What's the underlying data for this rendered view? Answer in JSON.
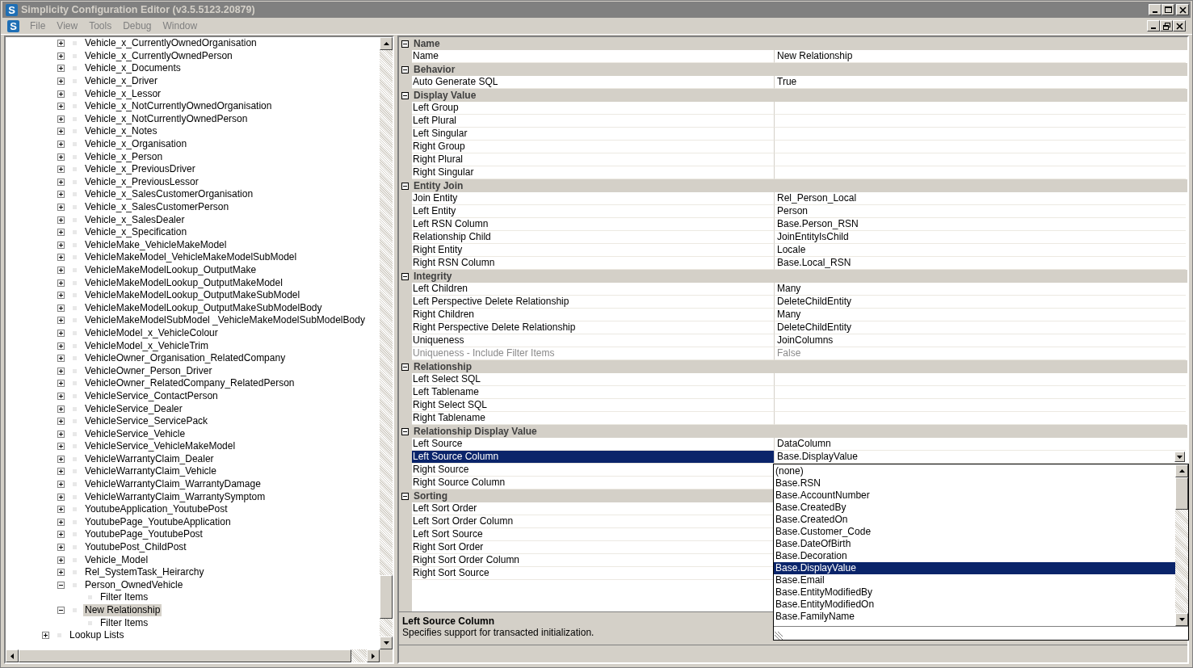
{
  "window": {
    "title": "Simplicity Configuration Editor (v3.5.5123.20879)",
    "icon_letter": "S"
  },
  "menu_bar": {
    "icon_letter": "S",
    "items": [
      "File",
      "View",
      "Tools",
      "Debug",
      "Window"
    ]
  },
  "tree": {
    "nodes": [
      {
        "label": "Vehicle_x_CurrentlyOwnedOrganisation",
        "expanded": false,
        "selected": false
      },
      {
        "label": "Vehicle_x_CurrentlyOwnedPerson",
        "expanded": false,
        "selected": false
      },
      {
        "label": "Vehicle_x_Documents",
        "expanded": false,
        "selected": false
      },
      {
        "label": "Vehicle_x_Driver",
        "expanded": false,
        "selected": false
      },
      {
        "label": "Vehicle_x_Lessor",
        "expanded": false,
        "selected": false
      },
      {
        "label": "Vehicle_x_NotCurrentlyOwnedOrganisation",
        "expanded": false,
        "selected": false
      },
      {
        "label": "Vehicle_x_NotCurrentlyOwnedPerson",
        "expanded": false,
        "selected": false
      },
      {
        "label": "Vehicle_x_Notes",
        "expanded": false,
        "selected": false
      },
      {
        "label": "Vehicle_x_Organisation",
        "expanded": false,
        "selected": false
      },
      {
        "label": "Vehicle_x_Person",
        "expanded": false,
        "selected": false
      },
      {
        "label": "Vehicle_x_PreviousDriver",
        "expanded": false,
        "selected": false
      },
      {
        "label": "Vehicle_x_PreviousLessor",
        "expanded": false,
        "selected": false
      },
      {
        "label": "Vehicle_x_SalesCustomerOrganisation",
        "expanded": false,
        "selected": false
      },
      {
        "label": "Vehicle_x_SalesCustomerPerson",
        "expanded": false,
        "selected": false
      },
      {
        "label": "Vehicle_x_SalesDealer",
        "expanded": false,
        "selected": false
      },
      {
        "label": "Vehicle_x_Specification",
        "expanded": false,
        "selected": false
      },
      {
        "label": "VehicleMake_VehicleMakeModel",
        "expanded": false,
        "selected": false
      },
      {
        "label": "VehicleMakeModel_VehicleMakeModelSubModel",
        "expanded": false,
        "selected": false
      },
      {
        "label": "VehicleMakeModelLookup_OutputMake",
        "expanded": false,
        "selected": false
      },
      {
        "label": "VehicleMakeModelLookup_OutputMakeModel",
        "expanded": false,
        "selected": false
      },
      {
        "label": "VehicleMakeModelLookup_OutputMakeSubModel",
        "expanded": false,
        "selected": false
      },
      {
        "label": "VehicleMakeModelLookup_OutputMakeSubModelBody",
        "expanded": false,
        "selected": false
      },
      {
        "label": "VehicleMakeModelSubModel _VehicleMakeModelSubModelBody",
        "expanded": false,
        "selected": false
      },
      {
        "label": "VehicleModel_x_VehicleColour",
        "expanded": false,
        "selected": false
      },
      {
        "label": "VehicleModel_x_VehicleTrim",
        "expanded": false,
        "selected": false
      },
      {
        "label": "VehicleOwner_Organisation_RelatedCompany",
        "expanded": false,
        "selected": false
      },
      {
        "label": "VehicleOwner_Person_Driver",
        "expanded": false,
        "selected": false
      },
      {
        "label": "VehicleOwner_RelatedCompany_RelatedPerson",
        "expanded": false,
        "selected": false
      },
      {
        "label": "VehicleService_ContactPerson",
        "expanded": false,
        "selected": false
      },
      {
        "label": "VehicleService_Dealer",
        "expanded": false,
        "selected": false
      },
      {
        "label": "VehicleService_ServicePack",
        "expanded": false,
        "selected": false
      },
      {
        "label": "VehicleService_Vehicle",
        "expanded": false,
        "selected": false
      },
      {
        "label": "VehicleService_VehicleMakeModel",
        "expanded": false,
        "selected": false
      },
      {
        "label": "VehicleWarrantyClaim_Dealer",
        "expanded": false,
        "selected": false
      },
      {
        "label": "VehicleWarrantyClaim_Vehicle",
        "expanded": false,
        "selected": false
      },
      {
        "label": "VehicleWarrantyClaim_WarrantyDamage",
        "expanded": false,
        "selected": false
      },
      {
        "label": "VehicleWarrantyClaim_WarrantySymptom",
        "expanded": false,
        "selected": false
      },
      {
        "label": "YoutubeApplication_YoutubePost",
        "expanded": false,
        "selected": false
      },
      {
        "label": "YoutubePage_YoutubeApplication",
        "expanded": false,
        "selected": false
      },
      {
        "label": "YoutubePage_YoutubePost",
        "expanded": false,
        "selected": false
      },
      {
        "label": "YoutubePost_ChildPost",
        "expanded": false,
        "selected": false
      },
      {
        "label": "Vehicle_Model",
        "expanded": false,
        "selected": false
      },
      {
        "label": "Rel_SystemTask_Heirarchy",
        "expanded": false,
        "selected": false
      },
      {
        "label": "Person_OwnedVehicle",
        "expanded": true,
        "selected": false,
        "children": [
          {
            "label": "Filter Items",
            "selected": false
          }
        ]
      },
      {
        "label": "New Relationship",
        "expanded": true,
        "selected": true,
        "children": [
          {
            "label": "Filter Items",
            "selected": false
          }
        ]
      }
    ],
    "root_nodes": [
      {
        "label": "Lookup Lists",
        "expanded": false,
        "selected": false
      }
    ]
  },
  "properties": {
    "categories": [
      {
        "name": "Name",
        "expanded": true,
        "rows": [
          {
            "name": "Name",
            "value": "New Relationship",
            "disabled": false,
            "selected": false
          }
        ]
      },
      {
        "name": "Behavior",
        "expanded": true,
        "rows": [
          {
            "name": "Auto Generate SQL",
            "value": "True",
            "disabled": false,
            "selected": false
          }
        ]
      },
      {
        "name": "Display Value",
        "expanded": true,
        "rows": [
          {
            "name": "Left Group",
            "disabled": false,
            "selected": false
          },
          {
            "name": "Left Plural",
            "disabled": false,
            "selected": false
          },
          {
            "name": "Left Singular",
            "disabled": false,
            "selected": false
          },
          {
            "name": "Right Group",
            "disabled": false,
            "selected": false
          },
          {
            "name": "Right Plural",
            "disabled": false,
            "selected": false
          },
          {
            "name": "Right Singular",
            "disabled": false,
            "selected": false
          }
        ]
      },
      {
        "name": "Entity Join",
        "expanded": true,
        "rows": [
          {
            "name": "Join Entity",
            "value": "Rel_Person_Local",
            "disabled": false,
            "selected": false
          },
          {
            "name": "Left Entity",
            "value": "Person",
            "disabled": false,
            "selected": false
          },
          {
            "name": "Left RSN Column",
            "value": "Base.Person_RSN",
            "disabled": false,
            "selected": false
          },
          {
            "name": "Relationship Child",
            "value": "JoinEntityIsChild",
            "disabled": false,
            "selected": false
          },
          {
            "name": "Right Entity",
            "value": "Locale",
            "disabled": false,
            "selected": false
          },
          {
            "name": "Right RSN Column",
            "value": "Base.Local_RSN",
            "disabled": false,
            "selected": false
          }
        ]
      },
      {
        "name": "Integrity",
        "expanded": true,
        "rows": [
          {
            "name": "Left Children",
            "value": "Many",
            "disabled": false,
            "selected": false
          },
          {
            "name": "Left Perspective Delete Relationship",
            "value": "DeleteChildEntity",
            "disabled": false,
            "selected": false
          },
          {
            "name": "Right Children",
            "value": "Many",
            "disabled": false,
            "selected": false
          },
          {
            "name": "Right Perspective Delete Relationship",
            "value": "DeleteChildEntity",
            "disabled": false,
            "selected": false
          },
          {
            "name": "Uniqueness",
            "value": "JoinColumns",
            "disabled": false,
            "selected": false
          },
          {
            "name": "Uniqueness - Include Filter Items",
            "value": "False",
            "disabled": true,
            "selected": false
          }
        ]
      },
      {
        "name": "Relationship",
        "expanded": true,
        "rows": [
          {
            "name": "Left Select SQL",
            "disabled": false,
            "selected": false
          },
          {
            "name": "Left Tablename",
            "disabled": false,
            "selected": false
          },
          {
            "name": "Right Select SQL",
            "disabled": false,
            "selected": false
          },
          {
            "name": "Right Tablename",
            "disabled": false,
            "selected": false
          }
        ]
      },
      {
        "name": "Relationship Display Value",
        "expanded": true,
        "rows": [
          {
            "name": "Left Source",
            "value": "DataColumn",
            "disabled": false,
            "selected": false
          },
          {
            "name": "Left Source Column",
            "value": "Base.DisplayValue",
            "disabled": false,
            "selected": true
          },
          {
            "name": "Right Source",
            "disabled": false,
            "selected": false
          },
          {
            "name": "Right Source Column",
            "disabled": false,
            "selected": false
          }
        ]
      },
      {
        "name": "Sorting",
        "expanded": true,
        "rows": [
          {
            "name": "Left Sort Order",
            "disabled": false,
            "selected": false
          },
          {
            "name": "Left Sort Order Column",
            "disabled": false,
            "selected": false
          },
          {
            "name": "Left Sort Source",
            "disabled": false,
            "selected": false
          },
          {
            "name": "Right Sort Order",
            "disabled": false,
            "selected": false
          },
          {
            "name": "Right Sort Order Column",
            "disabled": false,
            "selected": false
          },
          {
            "name": "Right Sort Source",
            "disabled": false,
            "selected": false
          }
        ]
      }
    ]
  },
  "dropdown": {
    "items": [
      {
        "label": "(none)",
        "selected": false
      },
      {
        "label": "Base.RSN",
        "selected": false
      },
      {
        "label": "Base.AccountNumber",
        "selected": false
      },
      {
        "label": "Base.CreatedBy",
        "selected": false
      },
      {
        "label": "Base.CreatedOn",
        "selected": false
      },
      {
        "label": "Base.Customer_Code",
        "selected": false
      },
      {
        "label": "Base.DateOfBirth",
        "selected": false
      },
      {
        "label": "Base.Decoration",
        "selected": false
      },
      {
        "label": "Base.DisplayValue",
        "selected": true
      },
      {
        "label": "Base.Email",
        "selected": false
      },
      {
        "label": "Base.EntityModifiedBy",
        "selected": false
      },
      {
        "label": "Base.EntityModifiedOn",
        "selected": false
      },
      {
        "label": "Base.FamilyName",
        "selected": false
      }
    ]
  },
  "description": {
    "title": "Left Source Column",
    "text": "Specifies support for transacted initialization."
  }
}
